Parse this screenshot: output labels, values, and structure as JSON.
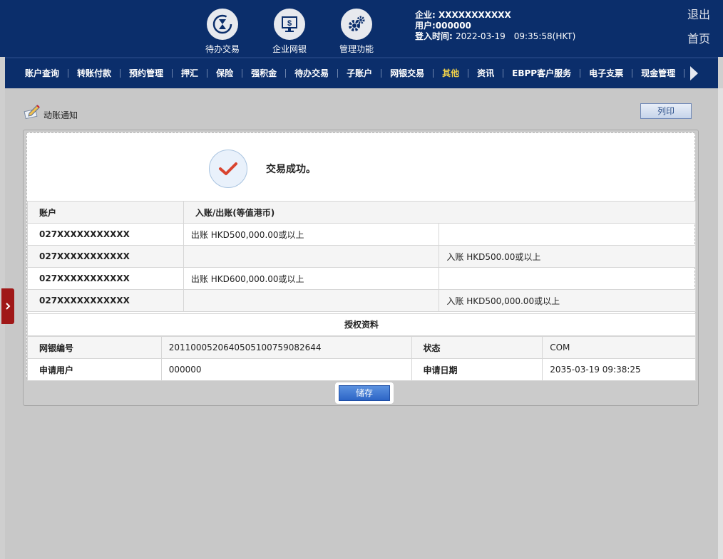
{
  "header": {
    "quick_links": [
      {
        "label": "待办交易",
        "icon": "hourglass-icon"
      },
      {
        "label": "企业网银",
        "icon": "monitor-dollar-icon"
      },
      {
        "label": "管理功能",
        "icon": "gears-icon"
      }
    ],
    "company": "企业: XXXXXXXXXXX",
    "user": "用户:000000",
    "login_time_label": "登入时间:",
    "login_time_value": "2022-03-19　09:35:58(HKT)",
    "logout": "退出",
    "home": "首页"
  },
  "nav": {
    "items": [
      "账户查询",
      "转账付款",
      "预约管理",
      "押汇",
      "保险",
      "强积金",
      "待办交易",
      "子账户",
      "网银交易",
      "其他",
      "资讯",
      "EBPP客户服务",
      "电子支票",
      "现金管理"
    ],
    "active": "其他"
  },
  "page": {
    "title": "动账通知",
    "print_label": "列印",
    "success_message": "交易成功。",
    "table_headers": [
      "账户",
      "入账/出账(等值港币)"
    ],
    "rows": [
      {
        "account": "027XXXXXXXXXXX",
        "out": "出账 HKD500,000.00或以上",
        "in": ""
      },
      {
        "account": "027XXXXXXXXXXX",
        "out": "",
        "in": "入账 HKD500.00或以上"
      },
      {
        "account": "027XXXXXXXXXXX",
        "out": "出账 HKD600,000.00或以上",
        "in": ""
      },
      {
        "account": "027XXXXXXXXXXX",
        "out": "",
        "in": "入账 HKD500,000.00或以上"
      }
    ],
    "auth_title": "授权资料",
    "auth": {
      "ebank_no_label": "网银编号",
      "ebank_no": "20110005206405051007590826​44",
      "status_label": "状态",
      "status": "COM",
      "applicant_label": "申请用户",
      "applicant": "000000",
      "apply_date_label": "申请日期",
      "apply_date": "2035-03-19 09:38:25"
    },
    "save_label": "储存"
  },
  "colors": {
    "header_bg": "#0b2e6b",
    "active_nav": "#f2d34a",
    "save_btn": "#2d65c6",
    "check": "#d9442f"
  }
}
